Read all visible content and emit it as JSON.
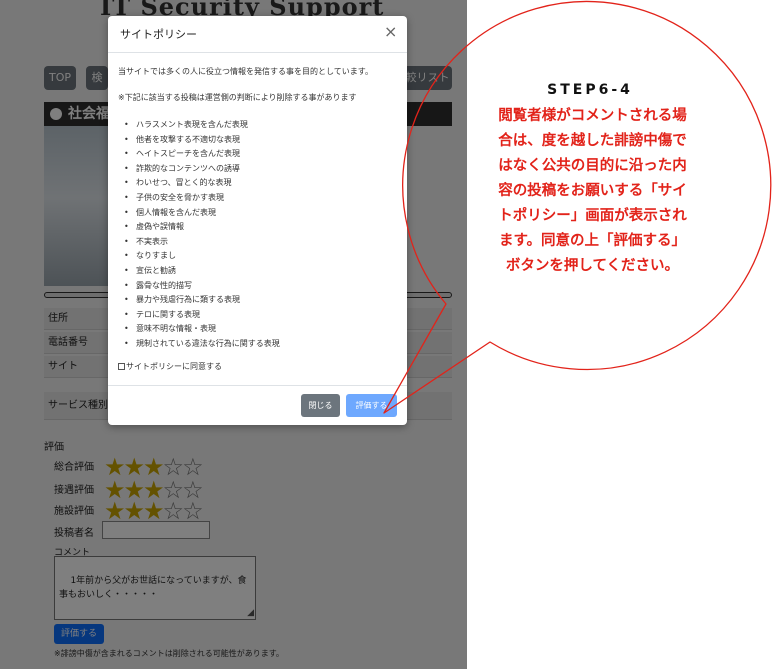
{
  "page": {
    "site_title": "IT Security Support",
    "nav": [
      "TOP",
      "検",
      "比較リスト"
    ],
    "section_title": "社会福",
    "info_rows": [
      "住所",
      "電話番号",
      "サイト",
      "サービス種別"
    ],
    "evaluation_label": "評価",
    "ratings": [
      {
        "label": "総合評価",
        "value": 3,
        "max": 5
      },
      {
        "label": "接遇評価",
        "value": 3,
        "max": 5
      },
      {
        "label": "施設評価",
        "value": 3,
        "max": 5
      }
    ],
    "name_label": "投稿者名",
    "name_value": "",
    "comment_label": "コメント",
    "comment_value": "1年前から父がお世話になっていますが、食事もおいしく・・・・・",
    "submit_label": "評価する",
    "note": "※誹謗中傷が含まれるコメントは削除される可能性があります。"
  },
  "modal": {
    "title": "サイトポリシー",
    "close_glyph": "×",
    "intro": "当サイトでは多くの人に役立つ情報を発信する事を目的としています。",
    "notice": "※下記に該当する投稿は運営側の判断により削除する事があります",
    "rules": [
      "ハラスメント表現を含んだ表現",
      "他者を攻撃する不適切な表現",
      "ヘイトスピーチを含んだ表現",
      "詐欺的なコンテンツへの誘導",
      "わいせつ、冒とく的な表現",
      "子供の安全を脅かす表現",
      "個人情報を含んだ表現",
      "虚偽や誤情報",
      "不実表示",
      "なりすまし",
      "宣伝と勧誘",
      "露骨な性的描写",
      "暴力や残虐行為に類する表現",
      "テロに関する表現",
      "意味不明な情報・表現",
      "規制されている違法な行為に関する表現"
    ],
    "agree_label": "サイトポリシーに同意する",
    "agree_checked": false,
    "close_button": "閉じる",
    "rate_button": "評価する"
  },
  "callout": {
    "step": "STEP6-4",
    "lines": [
      "閲覧者様がコメントされる場",
      "合は、度を越した誹謗中傷で",
      "はなく公共の目的に沿った内",
      "容の投稿をお願いする「サイ",
      "トポリシー」画面が表示され",
      "ます。同意の上「評価する」",
      "ボタンを押してください。"
    ]
  },
  "colors": {
    "callout_red": "#e2231a",
    "primary_button": "#0d6efd",
    "secondary_button": "#6c757d",
    "star_gold": "#c9a400"
  }
}
